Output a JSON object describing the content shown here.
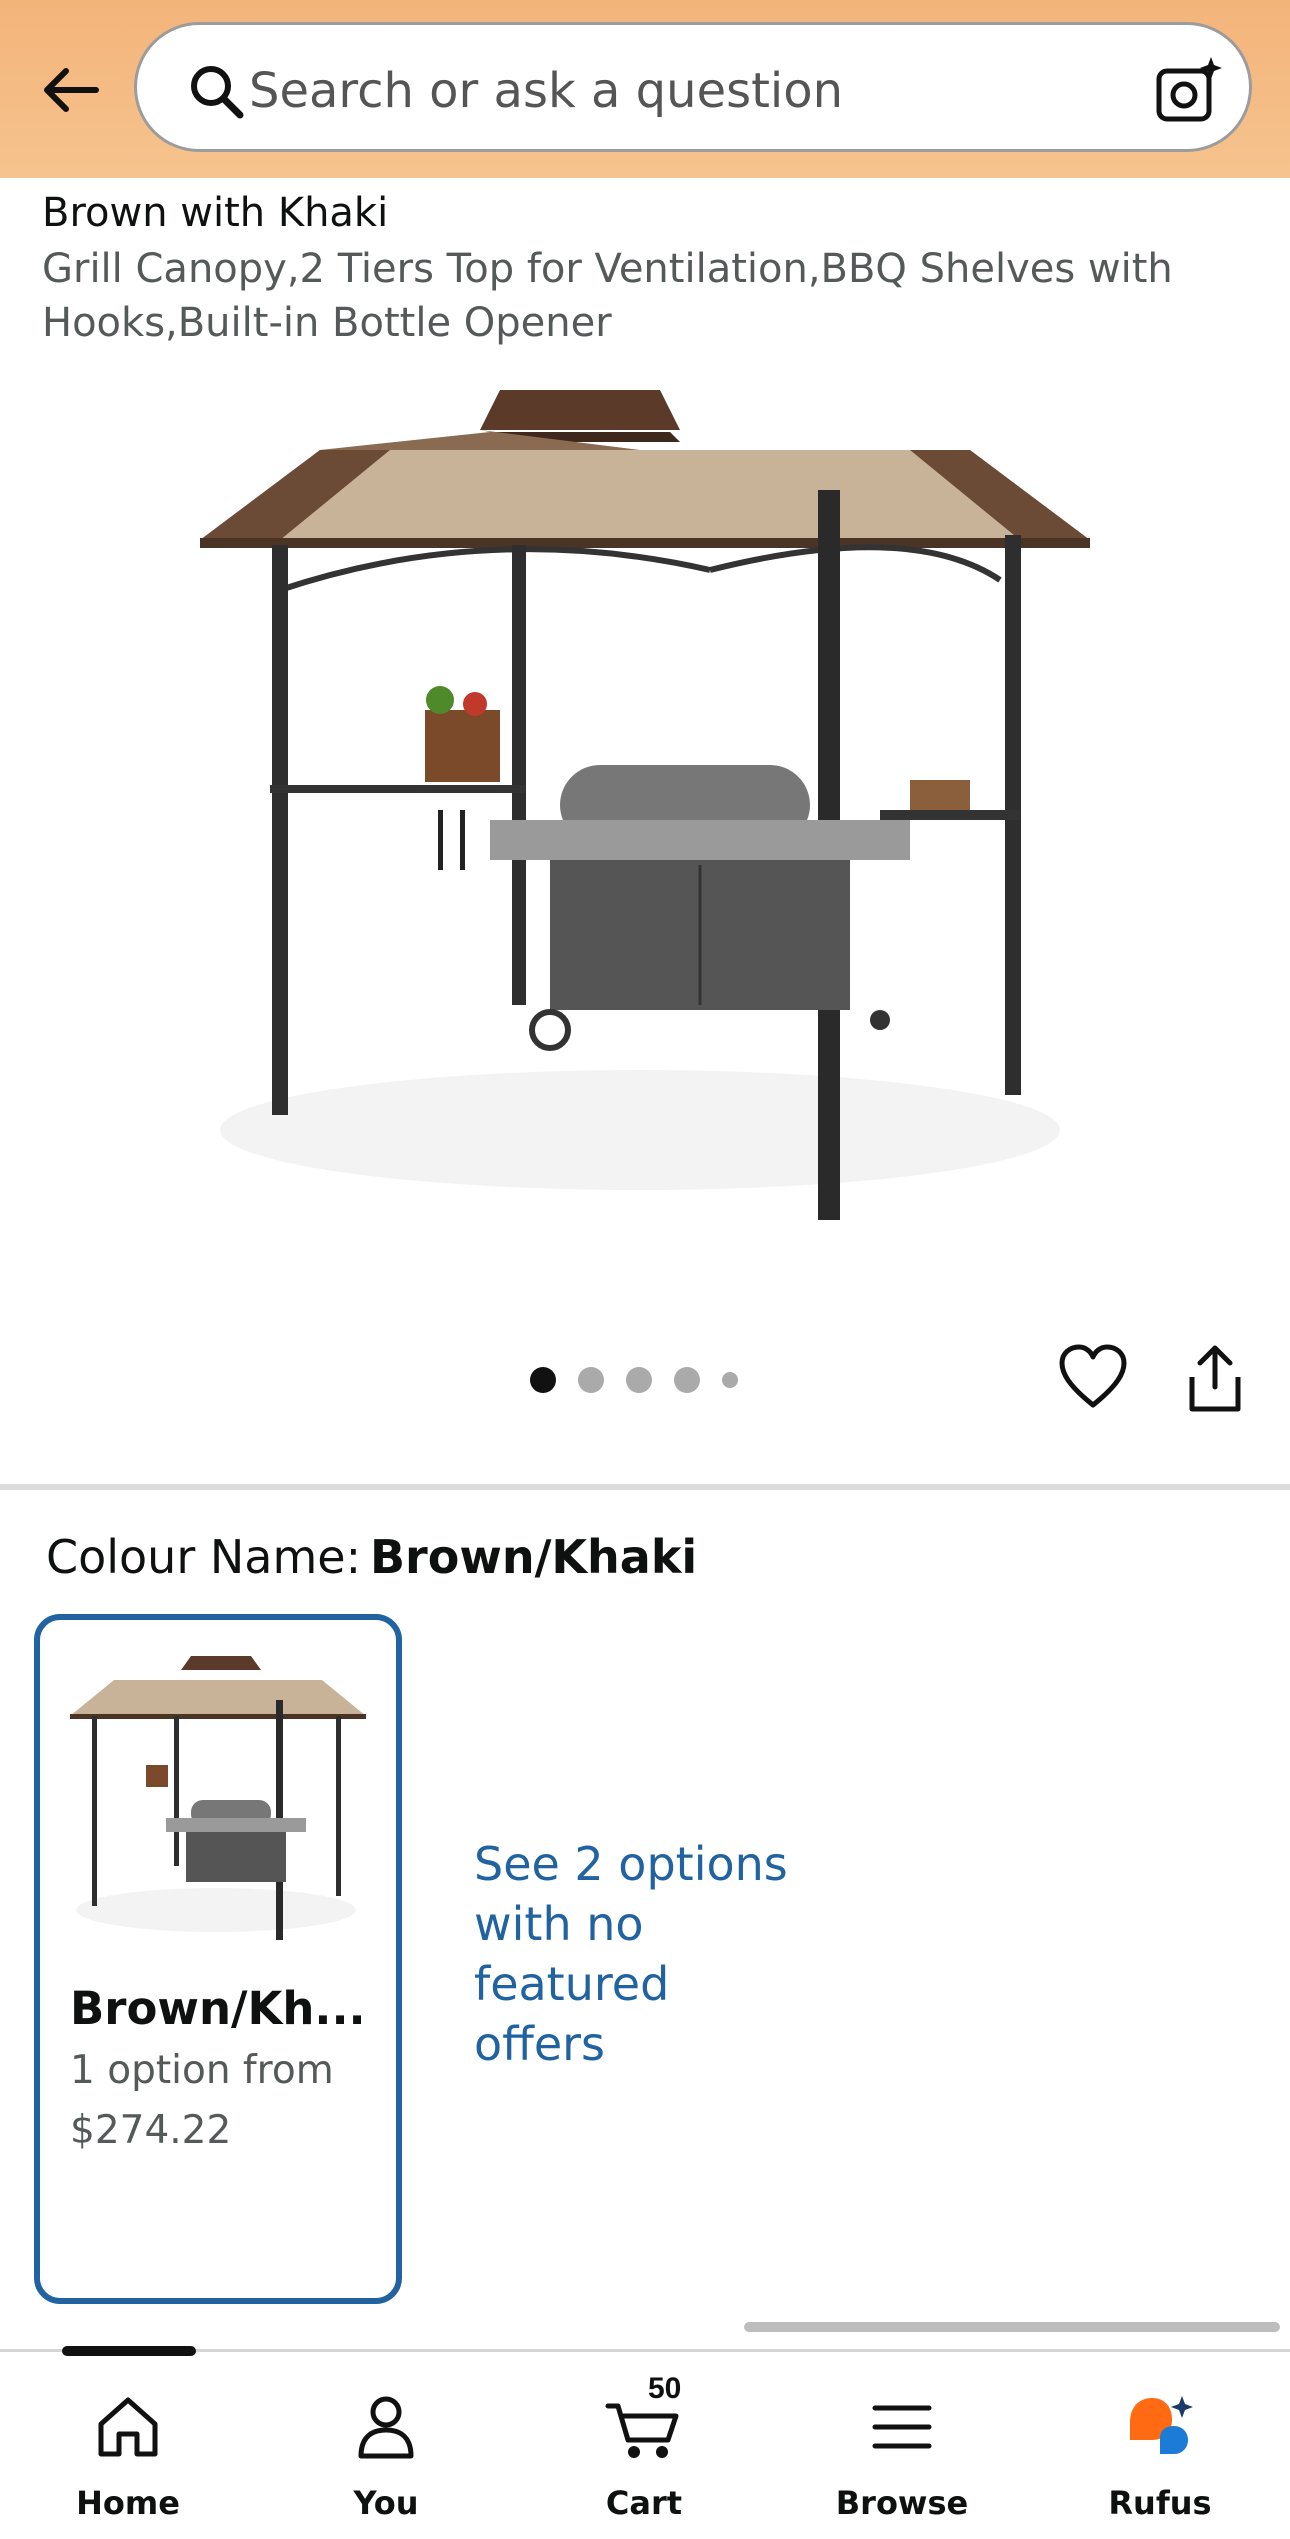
{
  "header": {
    "search_placeholder": "Search or ask a question"
  },
  "product": {
    "title_line": "Brown with Khaki",
    "subtitle": "Grill Canopy,2 Tiers Top for Ventilation,BBQ Shelves with Hooks,Built-in Bottle Opener",
    "image_count": 5,
    "active_image": 1
  },
  "colour": {
    "label": "Colour Name:",
    "value": "Brown/Khaki",
    "swatch": {
      "name": "Brown/Kh...",
      "options": "1 option from",
      "price": "$274.22"
    },
    "more_options_link": "See 2 options with no featured offers"
  },
  "nav": {
    "home": "Home",
    "you": "You",
    "cart": "Cart",
    "cart_count": "50",
    "browse": "Browse",
    "rufus": "Rufus"
  },
  "colors": {
    "header_bg": "#f4b87f",
    "link": "#2162a1",
    "swatch_border": "#2162a1",
    "rufus_orange": "#ff6a13",
    "rufus_blue": "#1c7bd6"
  }
}
